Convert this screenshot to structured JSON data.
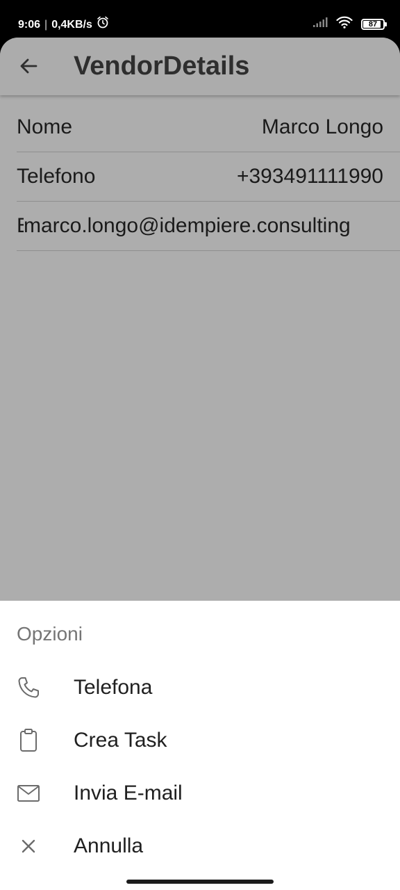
{
  "status_bar": {
    "time": "9:06",
    "separator": "|",
    "network_speed": "0,4KB/s",
    "battery_level": "87",
    "icons": [
      "alarm-icon",
      "signal-icon",
      "wifi-icon",
      "battery-icon"
    ]
  },
  "app_bar": {
    "title": "VendorDetails",
    "back_icon": "arrow-left-icon"
  },
  "details": [
    {
      "label": "Nome",
      "value": "Marco Longo"
    },
    {
      "label": "Telefono",
      "value": "+393491111990"
    },
    {
      "label": "E",
      "value": "marco.longo@idempiere.consulting"
    }
  ],
  "sheet": {
    "title": "Opzioni",
    "options": [
      {
        "label": "Telefona",
        "icon": "phone-icon"
      },
      {
        "label": "Crea Task",
        "icon": "clipboard-icon"
      },
      {
        "label": "Invia E-mail",
        "icon": "mail-icon"
      },
      {
        "label": "Annulla",
        "icon": "close-icon"
      }
    ]
  },
  "colors": {
    "scrim": "#adadad",
    "sheet_bg": "#ffffff",
    "title_text": "#2e2e2e",
    "sheet_title": "#757575"
  }
}
